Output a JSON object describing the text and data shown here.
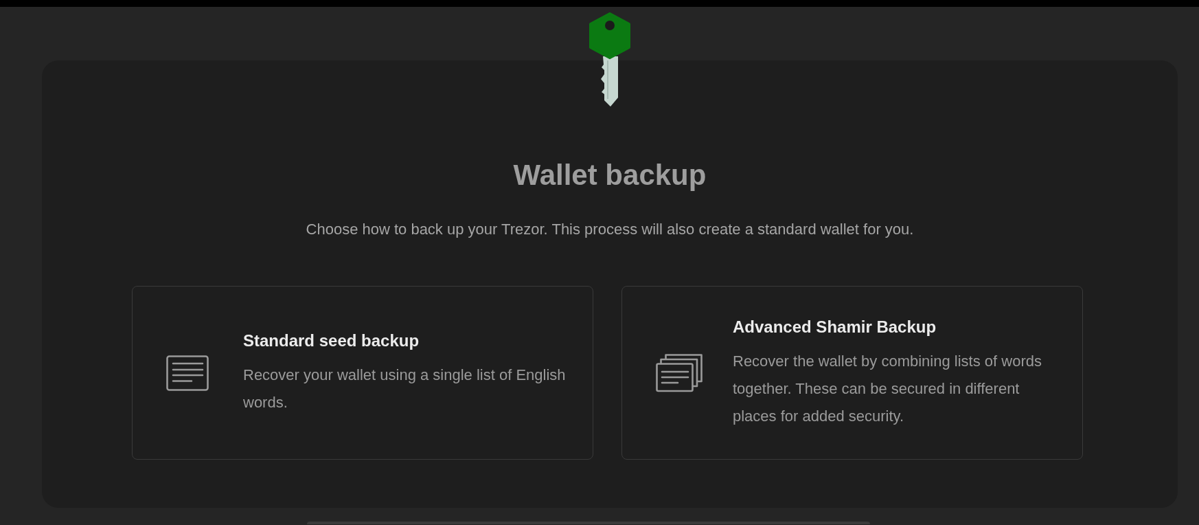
{
  "header": {
    "title": "Wallet backup",
    "subtitle": "Choose how to back up your Trezor. This process will also create a standard wallet for you."
  },
  "options": [
    {
      "kind": "single",
      "title": "Standard seed backup",
      "description": "Recover your wallet using a single list of English words."
    },
    {
      "kind": "multi",
      "title": "Advanced Shamir Backup",
      "description": "Recover the wallet by combining lists of words together. These can be secured in different places for added security."
    }
  ]
}
